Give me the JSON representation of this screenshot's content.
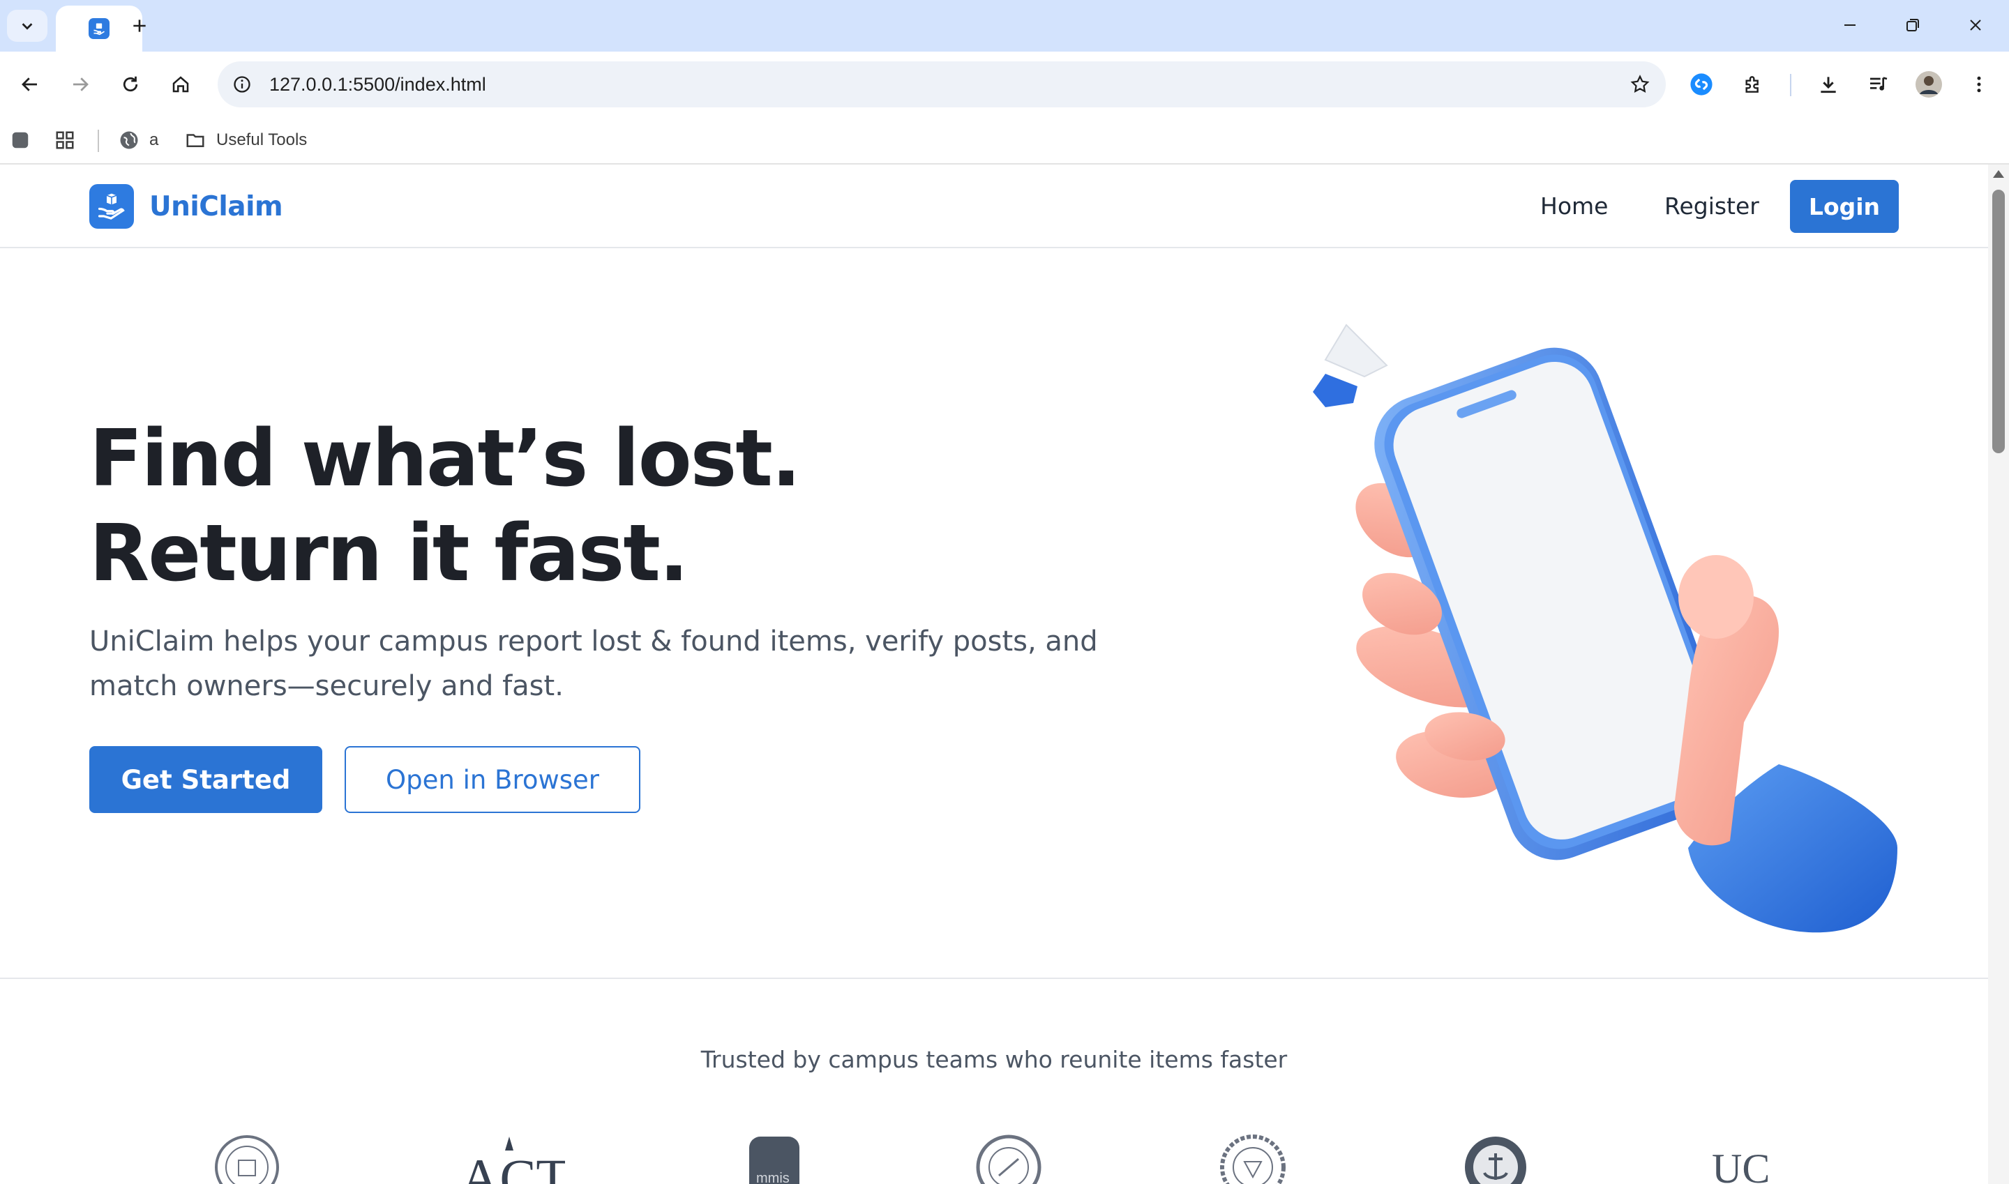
{
  "browser": {
    "url": "127.0.0.1:5500/index.html",
    "bookmarks": [
      {
        "label": "",
        "icon": "app-square-icon"
      },
      {
        "label": "",
        "icon": "apps-grid-icon"
      },
      {
        "label": "a",
        "icon": "globe-icon"
      },
      {
        "label": "Useful Tools",
        "icon": "folder-icon"
      }
    ]
  },
  "site": {
    "brand": "UniClaim",
    "nav": {
      "home": "Home",
      "register": "Register",
      "login": "Login"
    },
    "hero": {
      "title_line1": "Find what’s lost.",
      "title_line2": "Return it fast.",
      "subtitle": "UniClaim helps your campus report lost & found items, verify posts, and match owners—securely and fast.",
      "primary_cta": "Get Started",
      "secondary_cta": "Open in Browser"
    },
    "trusted": {
      "heading": "Trusted by campus teams who reunite items faster",
      "logos": [
        "university-seal-1",
        "act-logo",
        "mmis-logo",
        "normal-university-seal",
        "university-seal-5",
        "anchor-seal",
        "uc-logo"
      ]
    }
  },
  "colors": {
    "brand_blue": "#2b74d4",
    "chrome_tabstrip": "#d3e3fd",
    "heading": "#1e2128",
    "body_text": "#4b5563"
  }
}
